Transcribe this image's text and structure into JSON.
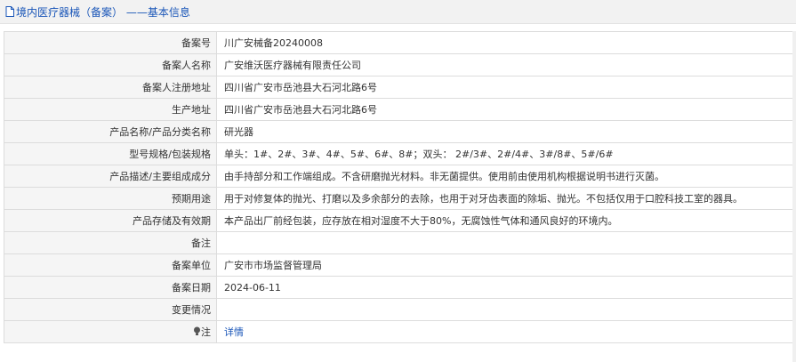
{
  "header": {
    "title": "境内医疗器械（备案） ——基本信息"
  },
  "rows": [
    {
      "label": "备案号",
      "value": "川广安械备20240008"
    },
    {
      "label": "备案人名称",
      "value": "广安维沃医疗器械有限责任公司"
    },
    {
      "label": "备案人注册地址",
      "value": "四川省广安市岳池县大石河北路6号"
    },
    {
      "label": "生产地址",
      "value": "四川省广安市岳池县大石河北路6号"
    },
    {
      "label": "产品名称/产品分类名称",
      "value": "研光器"
    },
    {
      "label": "型号规格/包装规格",
      "value": "单头：1#、2#、3#、4#、5#、6#、8#；双头： 2#/3#、2#/4#、3#/8#、5#/6#"
    },
    {
      "label": "产品描述/主要组成成分",
      "value": "由手持部分和工作端组成。不含研磨抛光材料。非无菌提供。使用前由使用机构根据说明书进行灭菌。"
    },
    {
      "label": "预期用途",
      "value": "用于对修复体的抛光、打磨以及多余部分的去除，也用于对牙齿表面的除垢、抛光。不包括仅用于口腔科技工室的器具。"
    },
    {
      "label": "产品存储及有效期",
      "value": "本产品出厂前经包装，应存放在相对湿度不大于80%，无腐蚀性气体和通风良好的环境内。"
    },
    {
      "label": "备注",
      "value": ""
    },
    {
      "label": "备案单位",
      "value": "广安市市场监督管理局"
    },
    {
      "label": "备案日期",
      "value": "2024-06-11"
    },
    {
      "label": "变更情况",
      "value": ""
    },
    {
      "label": "注",
      "value": "详情"
    }
  ]
}
